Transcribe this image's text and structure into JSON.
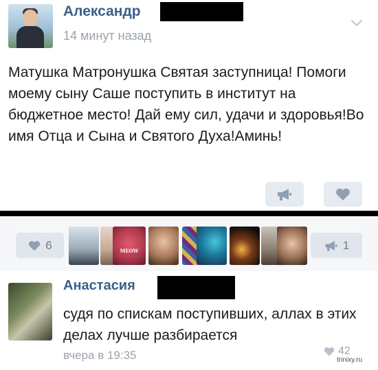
{
  "post": {
    "author": "Александр",
    "time": "14 минут назад",
    "text": "Матушка Матронушка Святая заступница! Помоги моему сыну Саше поступить в институт на бюджетное место! Дай ему сил, удачи и здоровья!Во имя Отца и Сына и Святого Духа!Аминь!"
  },
  "strip": {
    "likes_count": "6",
    "shares_count": "1",
    "liker_labels": [
      "",
      "",
      "MEOW",
      "",
      "",
      "",
      "",
      "",
      ""
    ]
  },
  "comment": {
    "author": "Анастасия",
    "text": "судя по спискам поступивших, аллах в этих делах лучше разбирается",
    "time": "вчера в 19:35",
    "likes_count": "42"
  },
  "watermark": "trinixy.ru",
  "colors": {
    "accent": "#3b5f8a",
    "button_bg": "#e1e6ec",
    "icon": "#8fa0b3",
    "meta": "#9aa3ad"
  },
  "icons": {
    "chevron": "chevron-down-icon",
    "share": "megaphone-icon",
    "like": "heart-icon"
  }
}
